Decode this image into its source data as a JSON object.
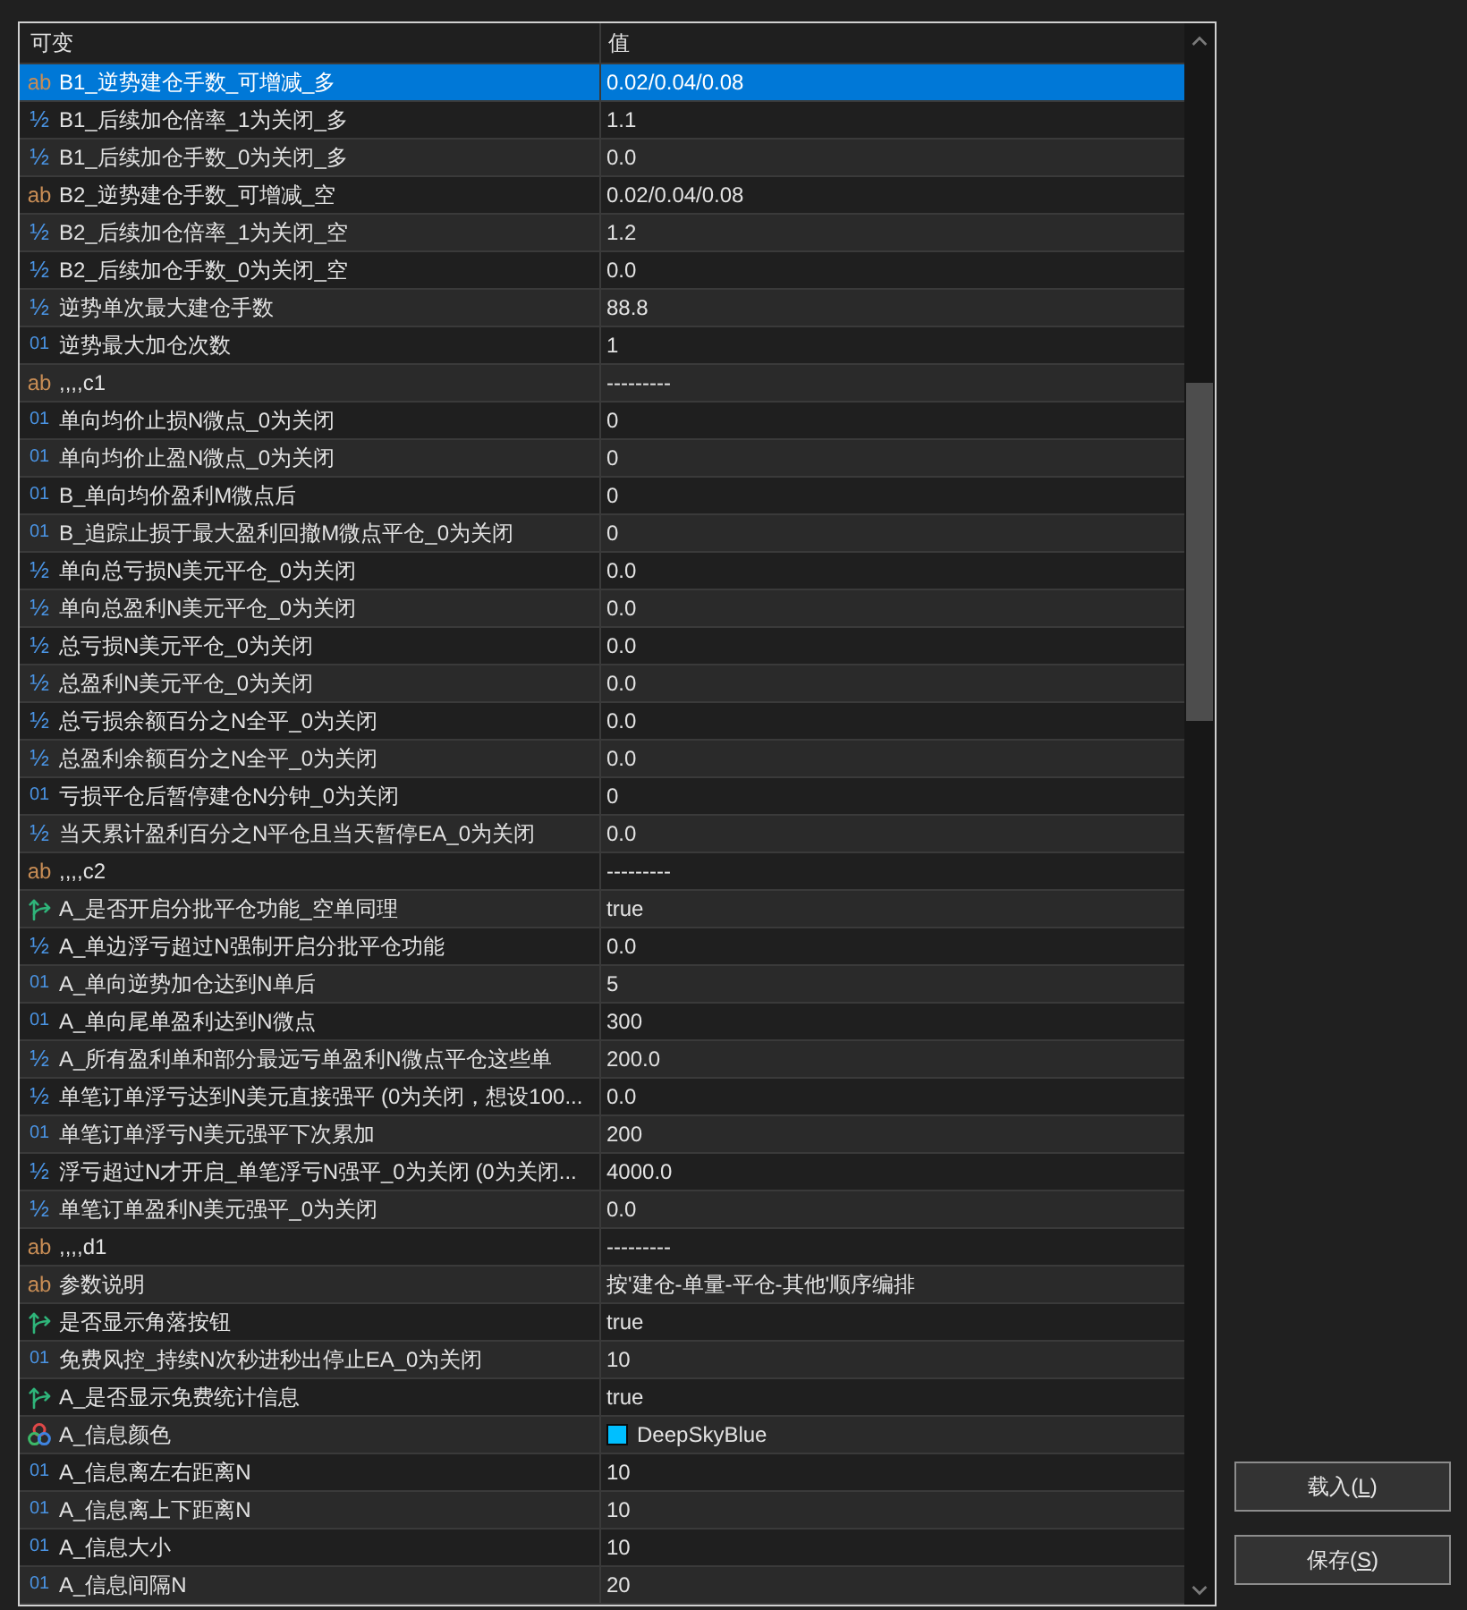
{
  "dialog": {
    "columns": [
      "可变",
      "值"
    ],
    "rows": [
      {
        "kind": "string",
        "icon": "ab",
        "name": "B1_逆势建仓手数_可增减_多",
        "value": "0.02/0.04/0.08",
        "selected": true
      },
      {
        "kind": "double",
        "icon": "½",
        "name": "B1_后续加仓倍率_1为关闭_多",
        "value": "1.1",
        "selected": false
      },
      {
        "kind": "double",
        "icon": "½",
        "name": "B1_后续加仓手数_0为关闭_多",
        "value": "0.0",
        "selected": false
      },
      {
        "kind": "string",
        "icon": "ab",
        "name": "B2_逆势建仓手数_可增减_空",
        "value": "0.02/0.04/0.08",
        "selected": false
      },
      {
        "kind": "double",
        "icon": "½",
        "name": "B2_后续加仓倍率_1为关闭_空",
        "value": "1.2",
        "selected": false
      },
      {
        "kind": "double",
        "icon": "½",
        "name": "B2_后续加仓手数_0为关闭_空",
        "value": "0.0",
        "selected": false
      },
      {
        "kind": "double",
        "icon": "½",
        "name": "逆势单次最大建仓手数",
        "value": "88.8",
        "selected": false
      },
      {
        "kind": "int",
        "icon": "01",
        "name": "逆势最大加仓次数",
        "value": "1",
        "selected": false
      },
      {
        "kind": "string",
        "icon": "ab",
        "name": ",,,,c1",
        "value": "---------",
        "selected": false
      },
      {
        "kind": "int",
        "icon": "01",
        "name": "单向均价止损N微点_0为关闭",
        "value": "0",
        "selected": false
      },
      {
        "kind": "int",
        "icon": "01",
        "name": "单向均价止盈N微点_0为关闭",
        "value": "0",
        "selected": false
      },
      {
        "kind": "int",
        "icon": "01",
        "name": "B_单向均价盈利M微点后",
        "value": "0",
        "selected": false
      },
      {
        "kind": "int",
        "icon": "01",
        "name": "B_追踪止损于最大盈利回撤M微点平仓_0为关闭",
        "value": "0",
        "selected": false
      },
      {
        "kind": "double",
        "icon": "½",
        "name": "单向总亏损N美元平仓_0为关闭",
        "value": "0.0",
        "selected": false
      },
      {
        "kind": "double",
        "icon": "½",
        "name": "单向总盈利N美元平仓_0为关闭",
        "value": "0.0",
        "selected": false
      },
      {
        "kind": "double",
        "icon": "½",
        "name": "总亏损N美元平仓_0为关闭",
        "value": "0.0",
        "selected": false
      },
      {
        "kind": "double",
        "icon": "½",
        "name": "总盈利N美元平仓_0为关闭",
        "value": "0.0",
        "selected": false
      },
      {
        "kind": "double",
        "icon": "½",
        "name": "总亏损余额百分之N全平_0为关闭",
        "value": "0.0",
        "selected": false
      },
      {
        "kind": "double",
        "icon": "½",
        "name": "总盈利余额百分之N全平_0为关闭",
        "value": "0.0",
        "selected": false
      },
      {
        "kind": "int",
        "icon": "01",
        "name": "亏损平仓后暂停建仓N分钟_0为关闭",
        "value": "0",
        "selected": false
      },
      {
        "kind": "double",
        "icon": "½",
        "name": "当天累计盈利百分之N平仓且当天暂停EA_0为关闭",
        "value": "0.0",
        "selected": false
      },
      {
        "kind": "string",
        "icon": "ab",
        "name": ",,,,c2",
        "value": "---------",
        "selected": false
      },
      {
        "kind": "bool",
        "name": "A_是否开启分批平仓功能_空单同理",
        "value": "true",
        "selected": false
      },
      {
        "kind": "double",
        "icon": "½",
        "name": "A_单边浮亏超过N强制开启分批平仓功能",
        "value": "0.0",
        "selected": false
      },
      {
        "kind": "int",
        "icon": "01",
        "name": "A_单向逆势加仓达到N单后",
        "value": "5",
        "selected": false
      },
      {
        "kind": "int",
        "icon": "01",
        "name": "A_单向尾单盈利达到N微点",
        "value": "300",
        "selected": false
      },
      {
        "kind": "double",
        "icon": "½",
        "name": "A_所有盈利单和部分最远亏单盈利N微点平仓这些单",
        "value": "200.0",
        "selected": false
      },
      {
        "kind": "double",
        "icon": "½",
        "name": "单笔订单浮亏达到N美元直接强平 (0为关闭，想设100...",
        "value": "0.0",
        "selected": false
      },
      {
        "kind": "int",
        "icon": "01",
        "name": "单笔订单浮亏N美元强平下次累加",
        "value": "200",
        "selected": false
      },
      {
        "kind": "double",
        "icon": "½",
        "name": "浮亏超过N才开启_单笔浮亏N强平_0为关闭 (0为关闭...",
        "value": "4000.0",
        "selected": false
      },
      {
        "kind": "double",
        "icon": "½",
        "name": "单笔订单盈利N美元强平_0为关闭",
        "value": "0.0",
        "selected": false
      },
      {
        "kind": "string",
        "icon": "ab",
        "name": ",,,,d1",
        "value": "---------",
        "selected": false
      },
      {
        "kind": "string",
        "icon": "ab",
        "name": "参数说明",
        "value": "按'建仓-单量-平仓-其他'顺序编排",
        "selected": false
      },
      {
        "kind": "bool",
        "name": "是否显示角落按钮",
        "value": "true",
        "selected": false
      },
      {
        "kind": "int",
        "icon": "01",
        "name": "免费风控_持续N次秒进秒出停止EA_0为关闭",
        "value": "10",
        "selected": false
      },
      {
        "kind": "bool",
        "name": "A_是否显示免费统计信息",
        "value": "true",
        "selected": false
      },
      {
        "kind": "color",
        "name": "A_信息颜色",
        "value": "DeepSkyBlue",
        "color": "#00bfff",
        "selected": false
      },
      {
        "kind": "int",
        "icon": "01",
        "name": "A_信息离左右距离N",
        "value": "10",
        "selected": false
      },
      {
        "kind": "int",
        "icon": "01",
        "name": "A_信息离上下距离N",
        "value": "10",
        "selected": false
      },
      {
        "kind": "int",
        "icon": "01",
        "name": "A_信息大小",
        "value": "10",
        "selected": false
      },
      {
        "kind": "int",
        "icon": "01",
        "name": "A_信息间隔N",
        "value": "20",
        "selected": false
      }
    ],
    "buttons": [
      {
        "label": "载入(",
        "access_key": "L",
        "label_end": ")"
      },
      {
        "label": "保存(",
        "access_key": "S",
        "label_end": ")"
      }
    ]
  }
}
